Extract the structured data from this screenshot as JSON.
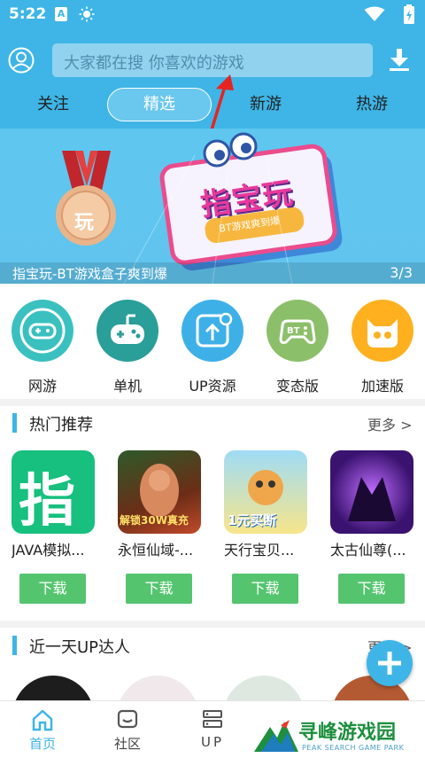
{
  "status_bar": {
    "time": "5:22",
    "notif_letter": "A"
  },
  "search": {
    "placeholder": "大家都在搜  你喜欢的游戏"
  },
  "tabs": [
    "关注",
    "精选",
    "新游",
    "热游"
  ],
  "banner": {
    "caption": "指宝玩-BT游戏盒子爽到爆",
    "counter": "3/3",
    "logo_text": "指宝玩",
    "ribbon_text": "BT游戏爽到爆",
    "medal_text": "玩"
  },
  "categories": [
    {
      "label": "网游",
      "color": "#3bc0c0",
      "icon": "gamepad-icon"
    },
    {
      "label": "单机",
      "color": "#2a9e98",
      "icon": "handheld-controller-icon"
    },
    {
      "label": "UP资源",
      "color": "#3eb0e8",
      "icon": "share-upload-icon"
    },
    {
      "label": "变态版",
      "color": "#8cbf6a",
      "icon": "bt-gamepad-icon"
    },
    {
      "label": "加速版",
      "color": "#ffb01f",
      "icon": "cat-face-icon"
    }
  ],
  "hot_section": {
    "title": "热门推荐",
    "more": "更多 >"
  },
  "games": [
    {
      "name": "JAVA模拟...",
      "download": "下载",
      "thumb_text": "指"
    },
    {
      "name": "永恒仙域-...",
      "download": "下载",
      "thumb_text": "解锁30W真充"
    },
    {
      "name": "天行宝贝...",
      "download": "下载",
      "thumb_text": "1元买断"
    },
    {
      "name": "太古仙尊(...",
      "download": "下载",
      "thumb_text": ""
    }
  ],
  "up_section": {
    "title": "近一天UP达人",
    "more": "更多 >"
  },
  "bottom_nav": [
    {
      "label": "首页",
      "icon": "home-icon"
    },
    {
      "label": "社区",
      "icon": "community-icon"
    },
    {
      "label": "UP",
      "icon": "server-icon"
    },
    {
      "label": "",
      "icon": ""
    },
    {
      "label": "",
      "icon": ""
    }
  ],
  "watermark": {
    "title": "寻峰游戏园",
    "subtitle": "PEAK SEARCH GAME PARK"
  },
  "colors": {
    "accent": "#3eb5e6",
    "download_green": "#55c46f"
  }
}
